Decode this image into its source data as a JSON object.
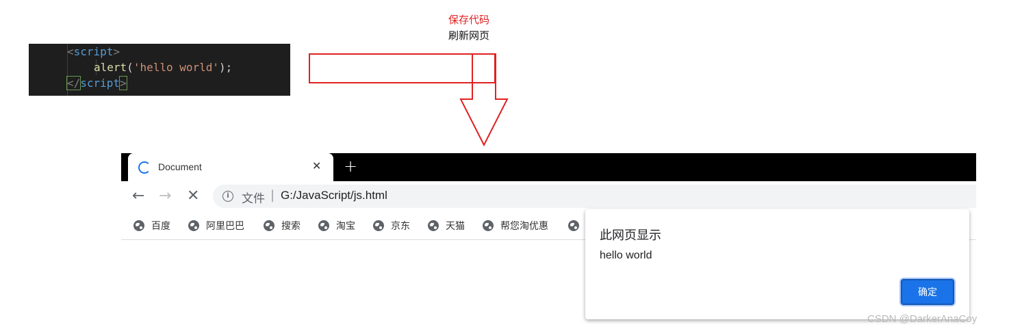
{
  "code": {
    "line1": {
      "open": "<",
      "name": "script",
      "close": ">"
    },
    "line2": {
      "fn": "alert",
      "lparen": "(",
      "str": "'hello world'",
      "rest": ");"
    },
    "line3": {
      "open": "</",
      "name": "script",
      "close": ">"
    }
  },
  "annotation": {
    "line1": "保存代码",
    "line2": "刷新网页",
    "colors": {
      "arrow": "#e02020"
    }
  },
  "browser": {
    "tab": {
      "title": "Document",
      "close": "✕",
      "new_tab": "+"
    },
    "nav": {
      "back": "←",
      "forward": "→",
      "stop": "✕"
    },
    "omnibox": {
      "info": "i",
      "scheme": "文件",
      "separator": "|",
      "url": "G:/JavaScript/js.html"
    },
    "bookmarks": [
      {
        "label": "百度"
      },
      {
        "label": "阿里巴巴"
      },
      {
        "label": "搜索"
      },
      {
        "label": "淘宝"
      },
      {
        "label": "京东"
      },
      {
        "label": "天猫"
      },
      {
        "label": "帮您淘优惠"
      },
      {
        "label": ""
      }
    ]
  },
  "dialog": {
    "title": "此网页显示",
    "message": "hello world",
    "ok_label": "确定"
  },
  "watermark": "CSDN @DarkerAnaCoy"
}
